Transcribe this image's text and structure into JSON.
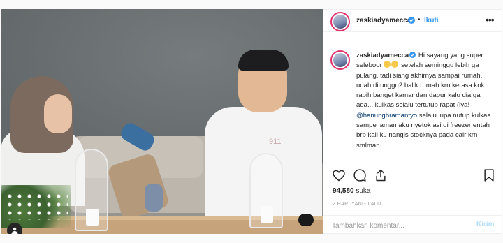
{
  "header": {
    "username": "zaskiadyamecca",
    "separator": "•",
    "follow_label": "Ikuti",
    "more_icon": "more-icon"
  },
  "caption": {
    "username": "zaskiadyamecca",
    "part1": " Hi sayang yang super seleboor ",
    "part2": " setelah seminggu lebih ga pulang, tadi siang akhirnya sampai rumah.. udah ditunggu2 balik rumah krn kerasa kok rapih banget kamar dan dapur kalo dia ga ada... kulkas selalu tertutup rapat (iya! ",
    "mention": "@hanungbramantyo",
    "part3": " selalu lupa nutup kulkas sampe jaman aku nyetok asi di freezer entah brp kali ku nangis stocknya pada cair krn smlman"
  },
  "engagement": {
    "likes_count": "94,580",
    "likes_label": "suka",
    "timestamp": "2 HARI YANG LALU"
  },
  "comment": {
    "placeholder": "Tambahkan komentar...",
    "post_label": "Kirim"
  },
  "photo": {
    "shirt_print": "911"
  },
  "colors": {
    "accent_blue": "#3897f0",
    "verified_blue": "#3897f0",
    "story_ring": "#e1306c",
    "post_disabled": "#b2dffc",
    "mention": "#003569"
  }
}
